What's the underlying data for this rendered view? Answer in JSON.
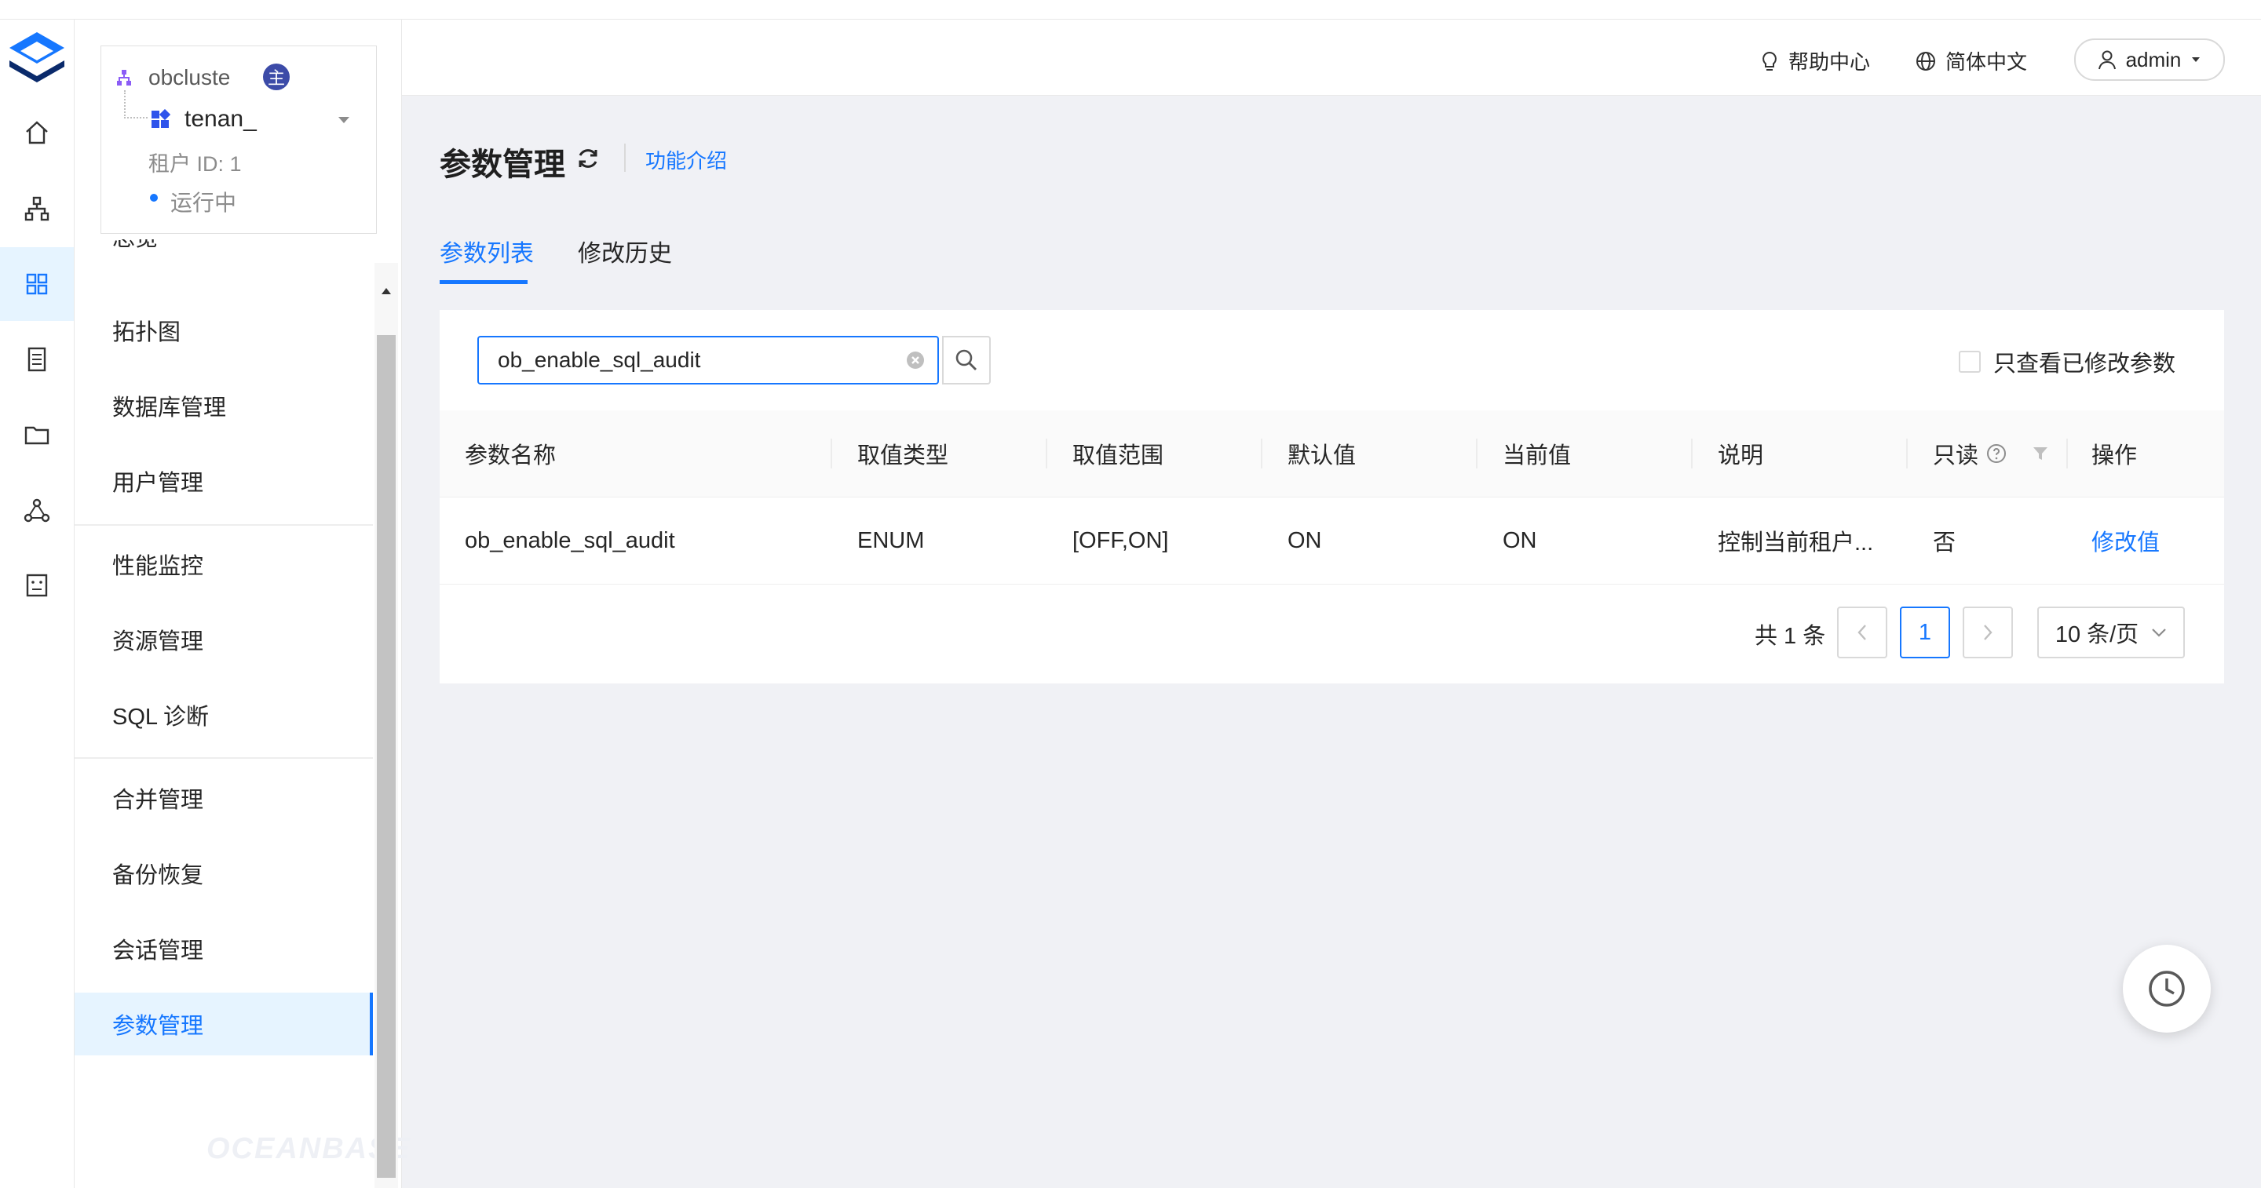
{
  "header": {
    "help_label": "帮助中心",
    "language_label": "简体中文",
    "user_label": "admin"
  },
  "tenant_card": {
    "cluster_name": "obcluste",
    "cluster_badge": "主",
    "tenant_name": "tenan_",
    "tenant_id_label": "租户 ID: 1",
    "status": "运行中"
  },
  "sidebar": {
    "items": [
      {
        "label": "总览"
      },
      {
        "label": "拓扑图"
      },
      {
        "label": "数据库管理"
      },
      {
        "label": "用户管理"
      },
      {
        "label": "性能监控"
      },
      {
        "label": "资源管理"
      },
      {
        "label": "SQL 诊断"
      },
      {
        "label": "合并管理"
      },
      {
        "label": "备份恢复"
      },
      {
        "label": "会话管理"
      },
      {
        "label": "参数管理"
      }
    ],
    "active_index": 10,
    "brand_watermark": "OCEANBASE"
  },
  "page": {
    "title": "参数管理",
    "intro_link": "功能介绍",
    "tabs": [
      {
        "label": "参数列表",
        "active": true
      },
      {
        "label": "修改历史",
        "active": false
      }
    ]
  },
  "search": {
    "value": "ob_enable_sql_audit",
    "only_modified_label": "只查看已修改参数"
  },
  "table": {
    "columns": [
      "参数名称",
      "取值类型",
      "取值范围",
      "默认值",
      "当前值",
      "说明",
      "只读",
      "操作"
    ],
    "rows": [
      {
        "name": "ob_enable_sql_audit",
        "type": "ENUM",
        "range": "[OFF,ON]",
        "default": "ON",
        "current": "ON",
        "desc": "控制当前租户...",
        "readonly": "否",
        "action": "修改值"
      }
    ]
  },
  "pagination": {
    "total_label": "共 1 条",
    "current_page": "1",
    "page_size_label": "10 条/页"
  },
  "colors": {
    "primary": "#1677ff",
    "active_bg": "#e6f4ff",
    "page_bg": "#f0f1f5",
    "status_running": "#1677ff",
    "cluster_icon": "#8b5cf6",
    "tenant_icon": "#2f54eb",
    "badge_bg": "#3c4ba8"
  }
}
